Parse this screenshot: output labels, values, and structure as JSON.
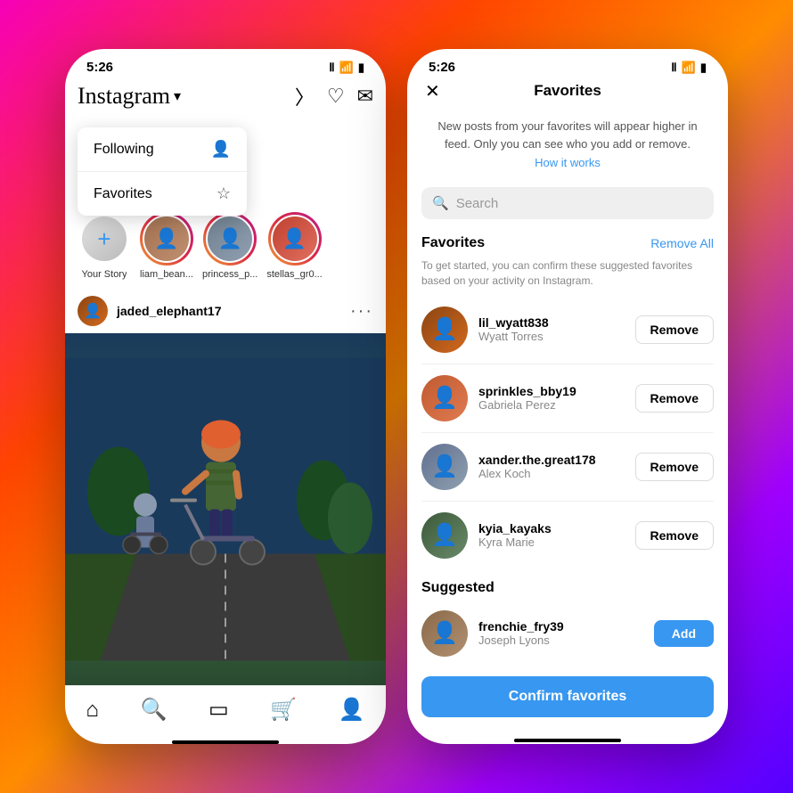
{
  "left_phone": {
    "status_time": "5:26",
    "logo": "Instagram",
    "logo_caret": "▾",
    "dropdown": {
      "following": "Following",
      "favorites": "Favorites"
    },
    "stories": [
      {
        "label": "Your Story",
        "type": "your"
      },
      {
        "label": "liam_bean...",
        "type": "av1"
      },
      {
        "label": "princess_p...",
        "type": "av2"
      },
      {
        "label": "stellas_gr0...",
        "type": "av3"
      }
    ],
    "post_username": "jaded_elephant17",
    "bottom_nav": [
      "home",
      "search",
      "reels",
      "shop",
      "profile"
    ]
  },
  "right_phone": {
    "status_time": "5:26",
    "screen_title": "Favorites",
    "info_text": "New posts from your favorites will appear higher in feed. Only you can see who you add or remove.",
    "how_it_works": "How it works",
    "search_placeholder": "Search",
    "favorites_label": "Favorites",
    "remove_all_label": "Remove All",
    "section_desc": "To get started, you can confirm these suggested favorites based on your activity on Instagram.",
    "favorites_list": [
      {
        "username": "lil_wyatt838",
        "real_name": "Wyatt Torres",
        "av_class": "av1"
      },
      {
        "username": "sprinkles_bby19",
        "real_name": "Gabriela Perez",
        "av_class": "av2"
      },
      {
        "username": "xander.the.great178",
        "real_name": "Alex Koch",
        "av_class": "av3"
      },
      {
        "username": "kyia_kayaks",
        "real_name": "Kyra Marie",
        "av_class": "av4"
      }
    ],
    "suggested_label": "Suggested",
    "suggested_list": [
      {
        "username": "frenchie_fry39",
        "real_name": "Joseph Lyons",
        "av_class": "av5"
      }
    ],
    "remove_btn_label": "Remove",
    "add_btn_label": "Add",
    "confirm_btn_label": "Confirm favorites"
  }
}
